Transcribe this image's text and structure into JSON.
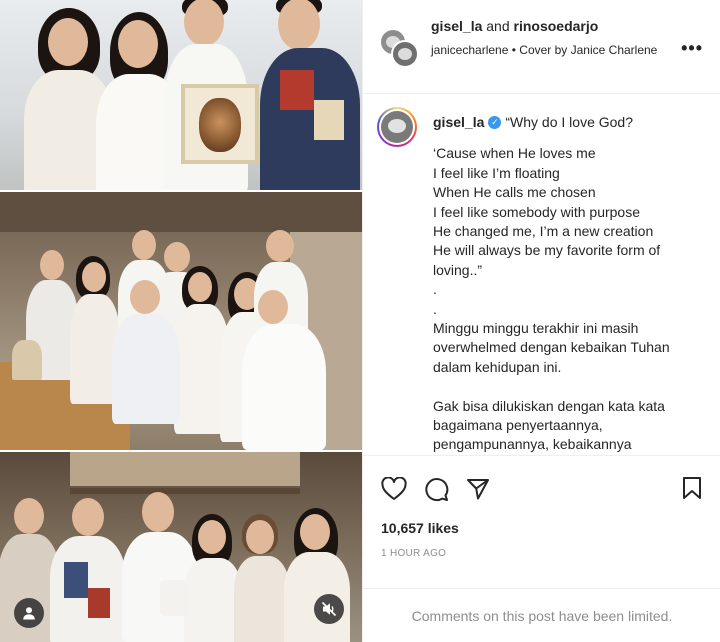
{
  "post": {
    "header": {
      "user_1": "gisel_la",
      "and_text": "and",
      "user_2": "rinosoedarjo",
      "audio_user": "janicecharlene",
      "audio_sep": "•",
      "audio_title": "Cover by Janice Charlene",
      "more_label": "•••"
    },
    "caption": {
      "username": "gisel_la",
      "verified_mark": "✓",
      "lines": [
        "“Why do I love God?",
        "",
        "‘Cause when He loves me",
        "I feel like I’m floating",
        "When He calls me chosen",
        "I feel like somebody with purpose",
        "He changed me, I’m a new creation",
        "He will always be my favorite form of",
        "loving..”",
        ".",
        ".",
        "Minggu minggu terakhir ini masih",
        "overwhelmed dengan kebaikan Tuhan",
        "dalam kehidupan ini.",
        "",
        "Gak bisa dilukiskan dengan kata kata",
        "bagaimana penyertaannya,",
        "pengampunannya, kebaikannya"
      ]
    },
    "likes": "10,657 likes",
    "time_ago": "1 HOUR AGO",
    "comments_limited": "Comments on this post have been limited.",
    "icons": {
      "like": "heart-icon",
      "comment": "comment-icon",
      "share": "share-icon",
      "save": "bookmark-icon",
      "tags": "user-tag-icon",
      "mute": "mute-icon"
    }
  }
}
